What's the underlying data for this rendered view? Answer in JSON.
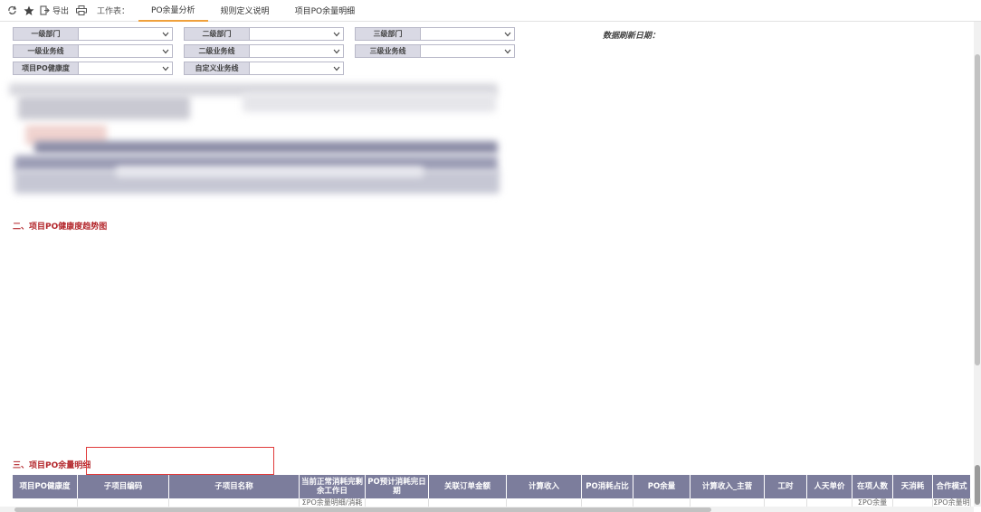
{
  "toolbar": {
    "export_label": "导出",
    "workbook_label": "工作表：",
    "tabs": [
      {
        "label": "PO余量分析",
        "active": true
      },
      {
        "label": "规则定义说明",
        "active": false
      },
      {
        "label": "项目PO余量明细",
        "active": false
      }
    ]
  },
  "filters": {
    "row1": [
      "一级部门",
      "二级部门",
      "三级部门"
    ],
    "row2": [
      "一级业务线",
      "二级业务线",
      "三级业务线"
    ],
    "row3": [
      "项目PO健康度",
      "自定义业务线"
    ]
  },
  "refresh_label": "数据刷新日期：",
  "sections": {
    "trend_title": "二、项目PO健康度趋势图",
    "detail_title": "三、项目PO余量明细"
  },
  "table": {
    "headers": [
      "项目PO健康度",
      "子项目编码",
      "子项目名称",
      "当前正常消耗完剩余工作日",
      "PO预计消耗完日期",
      "关联订单金额",
      "计算收入",
      "PO消耗占比",
      "PO余量",
      "计算收入_主营",
      "工时",
      "人天单价",
      "在项人数",
      "天消耗",
      "合作模式"
    ],
    "first_row": [
      "",
      "",
      "",
      "ΣPO余量明细/消耗",
      "",
      "",
      "",
      "",
      "",
      "",
      "",
      "",
      "ΣPO余量",
      "",
      "ΣPO余量明"
    ]
  },
  "colors": {
    "accent_tab": "#f0a13c",
    "section_title": "#b3262b",
    "table_header": "#7c7d9c",
    "filter_label_bg": "#d9d9e4",
    "highlight_border": "#e03a3a"
  }
}
